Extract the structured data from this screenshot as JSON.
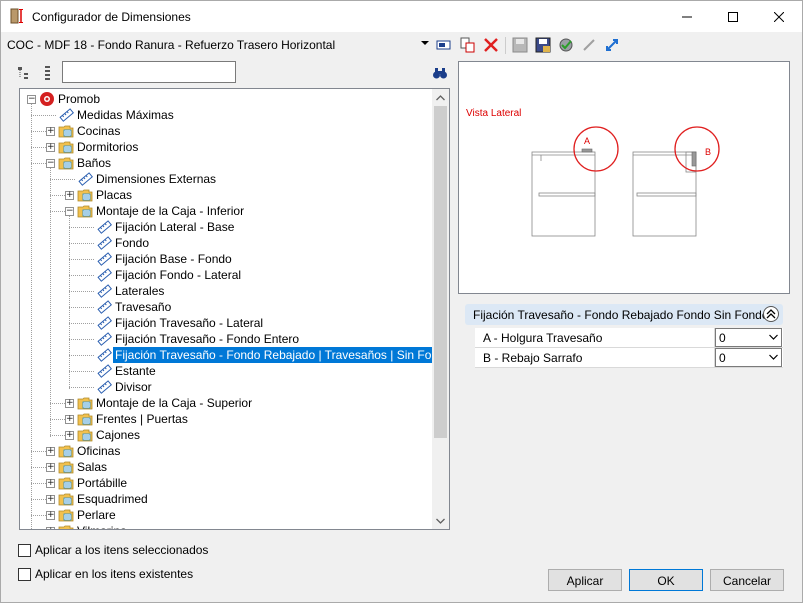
{
  "window": {
    "title": "Configurador de Dimensiones"
  },
  "config_bar": {
    "current": "COC - MDF 18 - Fondo Ranura - Refuerzo Trasero Horizontal"
  },
  "search": {
    "value": "",
    "placeholder": ""
  },
  "tree": {
    "nodes": [
      {
        "label": "Promob",
        "level": 0,
        "expander": "minus",
        "icon": "promob-logo-icon"
      },
      {
        "label": "Medidas Máximas",
        "level": 1,
        "expander": "",
        "icon": "ruler-icon"
      },
      {
        "label": "Cocinas",
        "level": 1,
        "expander": "plus",
        "icon": "folder-icon"
      },
      {
        "label": "Dormitorios",
        "level": 1,
        "expander": "plus",
        "icon": "folder-icon"
      },
      {
        "label": "Baños",
        "level": 1,
        "expander": "minus",
        "icon": "folder-icon"
      },
      {
        "label": "Dimensiones Externas",
        "level": 2,
        "expander": "",
        "icon": "ruler-icon"
      },
      {
        "label": "Placas",
        "level": 2,
        "expander": "plus",
        "icon": "folder-icon"
      },
      {
        "label": "Montaje de la Caja - Inferior",
        "level": 2,
        "expander": "minus",
        "icon": "folder-icon"
      },
      {
        "label": "Fijación Lateral - Base",
        "level": 3,
        "expander": "",
        "icon": "ruler-icon"
      },
      {
        "label": "Fondo",
        "level": 3,
        "expander": "",
        "icon": "ruler-icon"
      },
      {
        "label": " Fijación Base - Fondo",
        "level": 3,
        "expander": "",
        "icon": "ruler-icon"
      },
      {
        "label": "Fijación Fondo - Lateral",
        "level": 3,
        "expander": "",
        "icon": "ruler-icon"
      },
      {
        "label": "Laterales",
        "level": 3,
        "expander": "",
        "icon": "ruler-icon"
      },
      {
        "label": "Travesaño",
        "level": 3,
        "expander": "",
        "icon": "ruler-icon"
      },
      {
        "label": "Fijación Travesaño - Lateral",
        "level": 3,
        "expander": "",
        "icon": "ruler-icon"
      },
      {
        "label": "Fijación Travesaño - Fondo Entero",
        "level": 3,
        "expander": "",
        "icon": "ruler-icon"
      },
      {
        "label": "Fijación Travesaño - Fondo Rebajado | Travesaños | Sin Fondo",
        "level": 3,
        "expander": "",
        "icon": "ruler-icon",
        "selected": true
      },
      {
        "label": "Estante",
        "level": 3,
        "expander": "",
        "icon": "ruler-icon"
      },
      {
        "label": "Divisor",
        "level": 3,
        "expander": "",
        "icon": "ruler-icon"
      },
      {
        "label": "Montaje de la Caja - Superior",
        "level": 2,
        "expander": "plus",
        "icon": "folder-icon"
      },
      {
        "label": "Frentes | Puertas",
        "level": 2,
        "expander": "plus",
        "icon": "folder-icon"
      },
      {
        "label": "Cajones",
        "level": 2,
        "expander": "plus",
        "icon": "folder-icon"
      },
      {
        "label": "Oficinas",
        "level": 1,
        "expander": "plus",
        "icon": "folder-icon"
      },
      {
        "label": "Salas",
        "level": 1,
        "expander": "plus",
        "icon": "folder-icon"
      },
      {
        "label": "Portábille",
        "level": 1,
        "expander": "plus",
        "icon": "folder-icon"
      },
      {
        "label": "Esquadrimed",
        "level": 1,
        "expander": "plus",
        "icon": "folder-icon"
      },
      {
        "label": "Perlare",
        "level": 1,
        "expander": "plus",
        "icon": "folder-icon"
      },
      {
        "label": "Vilmarina",
        "level": 1,
        "expander": "plus",
        "icon": "folder-icon"
      }
    ]
  },
  "preview": {
    "label": "Vista Lateral",
    "marker_a": "A",
    "marker_b": "B"
  },
  "properties": {
    "header": "Fijación Travesaño - Fondo Rebajado Fondo Sin Fondo",
    "rows": [
      {
        "name": "A - Holgura Travesaño",
        "value": "0"
      },
      {
        "name": "B - Rebajo Sarrafo",
        "value": "0"
      }
    ]
  },
  "options": {
    "apply_selected": "Aplicar a los itens seleccionados",
    "apply_existing": "Aplicar en los itens existentes"
  },
  "buttons": {
    "apply": "Aplicar",
    "ok": "OK",
    "cancel": "Cancelar"
  },
  "colors": {
    "selection": "#0078d7",
    "folder": "#f2c14e",
    "accent_red": "#d00000",
    "prop_header": "#dce8f5"
  }
}
